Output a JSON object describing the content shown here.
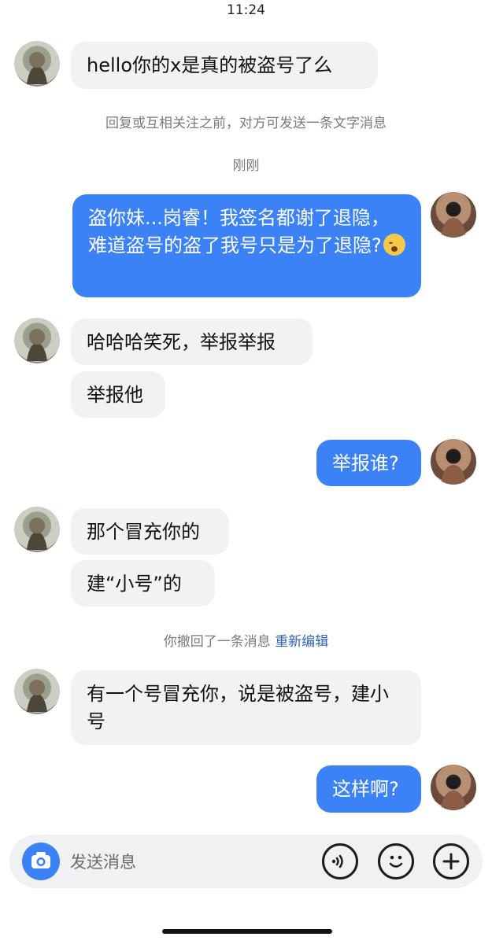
{
  "status_bar": {
    "time": "11:24"
  },
  "conversation": {
    "system_notices": {
      "reply_hint": "回复或互相关注之前，对方可发送一条文字消息",
      "just_now": "刚刚",
      "recall_text": "你撤回了一条消息",
      "recall_action": "重新编辑"
    },
    "messages": [
      {
        "side": "in",
        "text": "hello你的x是真的被盗号了么"
      },
      {
        "side": "out",
        "text": "盗你妹...岗睿！我签名都谢了退隐，难道盗号的盗了我号只是为了退隐?"
      },
      {
        "side": "in",
        "text": "哈哈哈笑死，举报举报"
      },
      {
        "side": "in",
        "text": "举报他"
      },
      {
        "side": "out",
        "text": "举报谁?"
      },
      {
        "side": "in",
        "text": "那个冒充你的"
      },
      {
        "side": "in",
        "text": "建“小号”的"
      },
      {
        "side": "in",
        "text": "有一个号冒充你，说是被盗号，建小号"
      },
      {
        "side": "out",
        "text": "这样啊?"
      }
    ],
    "emoji_after_message_2": "sad-face-emoji"
  },
  "composer": {
    "placeholder": "发送消息",
    "camera_icon": "camera-icon",
    "voice_icon": "voice-icon",
    "emoji_icon": "smiley-icon",
    "add_icon": "plus-icon"
  },
  "colors": {
    "outgoing_bubble": "#3b82f6",
    "incoming_bubble": "#f2f2f5",
    "link": "#2e62b8"
  }
}
